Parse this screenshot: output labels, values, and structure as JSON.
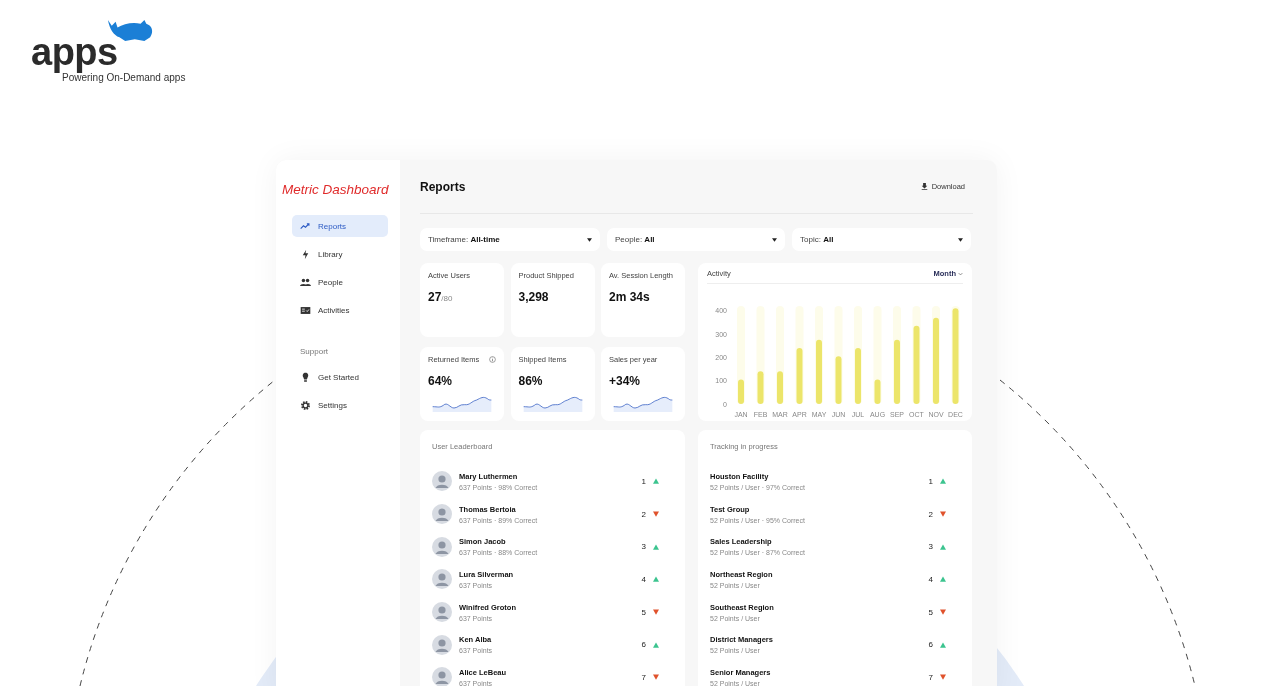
{
  "brand": {
    "logo": "apps",
    "tagline": "Powering On-Demand apps"
  },
  "sidebar": {
    "title": "Metric Dashboard",
    "items": [
      {
        "label": "Reports",
        "selected": true
      },
      {
        "label": "Library",
        "selected": false
      },
      {
        "label": "People",
        "selected": false
      },
      {
        "label": "Activities",
        "selected": false
      }
    ],
    "section": "Support",
    "support_items": [
      {
        "label": "Get Started",
        "selected": false
      },
      {
        "label": "Settings",
        "selected": false
      }
    ]
  },
  "header": {
    "title": "Reports",
    "download": "Download"
  },
  "filters": [
    {
      "label": "Timeframe:",
      "value": "All-time"
    },
    {
      "label": "People:",
      "value": "All"
    },
    {
      "label": "Topic:",
      "value": "All"
    }
  ],
  "stats": [
    {
      "label": "Active Users",
      "value": "27",
      "suffix": "/80",
      "kind": "plain"
    },
    {
      "label": "Product Shipped",
      "value": "3,298",
      "kind": "plain"
    },
    {
      "label": "Av. Session Length",
      "value": "2m 34s",
      "kind": "plain"
    },
    {
      "label": "Returned Items",
      "value": "64%",
      "kind": "spark",
      "info": true
    },
    {
      "label": "Shipped Items",
      "value": "86%",
      "kind": "spark"
    },
    {
      "label": "Sales per year",
      "value": "+34%",
      "kind": "spark"
    }
  ],
  "activity": {
    "title": "Activity",
    "period": "Month",
    "chart_data": {
      "type": "bar",
      "categories": [
        "JAN",
        "FEB",
        "MAR",
        "APR",
        "MAY",
        "JUN",
        "JUL",
        "AUG",
        "SEP",
        "OCT",
        "NOV",
        "DEC"
      ],
      "series": [
        {
          "color": "#ece56a",
          "values": [
            105,
            140,
            140,
            240,
            275,
            205,
            240,
            105,
            275,
            335,
            370,
            410
          ]
        }
      ],
      "ylim": [
        0,
        420
      ],
      "yticks": [
        0,
        100,
        200,
        300,
        400
      ]
    }
  },
  "leaderboard": {
    "title": "User Leaderboard",
    "rows": [
      {
        "name": "Mary Luthermen",
        "detail": "637 Points · 98% Correct",
        "rank": "1",
        "rising": true
      },
      {
        "name": "Thomas Bertoia",
        "detail": "637 Points · 89% Correct",
        "rank": "2",
        "rising": false
      },
      {
        "name": "Simon Jacob",
        "detail": "637 Points · 88% Correct",
        "rank": "3",
        "rising": true
      },
      {
        "name": "Lura Silverman",
        "detail": "637 Points",
        "rank": "4",
        "rising": true
      },
      {
        "name": "Winifred Groton",
        "detail": "637 Points",
        "rank": "5",
        "rising": false
      },
      {
        "name": "Ken Alba",
        "detail": "637 Points",
        "rank": "6",
        "rising": true
      },
      {
        "name": "Alice LeBeau",
        "detail": "637 Points",
        "rank": "7",
        "rising": false
      }
    ]
  },
  "tracking": {
    "title": "Tracking in progress",
    "rows": [
      {
        "name": "Houston Facility",
        "detail": "52 Points / User · 97% Correct",
        "rank": "1",
        "rising": true
      },
      {
        "name": "Test Group",
        "detail": "52 Points / User · 95% Correct",
        "rank": "2",
        "rising": false
      },
      {
        "name": "Sales Leadership",
        "detail": "52 Points / User · 87% Correct",
        "rank": "3",
        "rising": true
      },
      {
        "name": "Northeast Region",
        "detail": "52 Points / User",
        "rank": "4",
        "rising": true
      },
      {
        "name": "Southeast Region",
        "detail": "52 Points / User",
        "rank": "5",
        "rising": false
      },
      {
        "name": "District Managers",
        "detail": "52 Points / User",
        "rank": "6",
        "rising": true
      },
      {
        "name": "Senior Managers",
        "detail": "52 Points / User",
        "rank": "7",
        "rising": false
      }
    ]
  }
}
